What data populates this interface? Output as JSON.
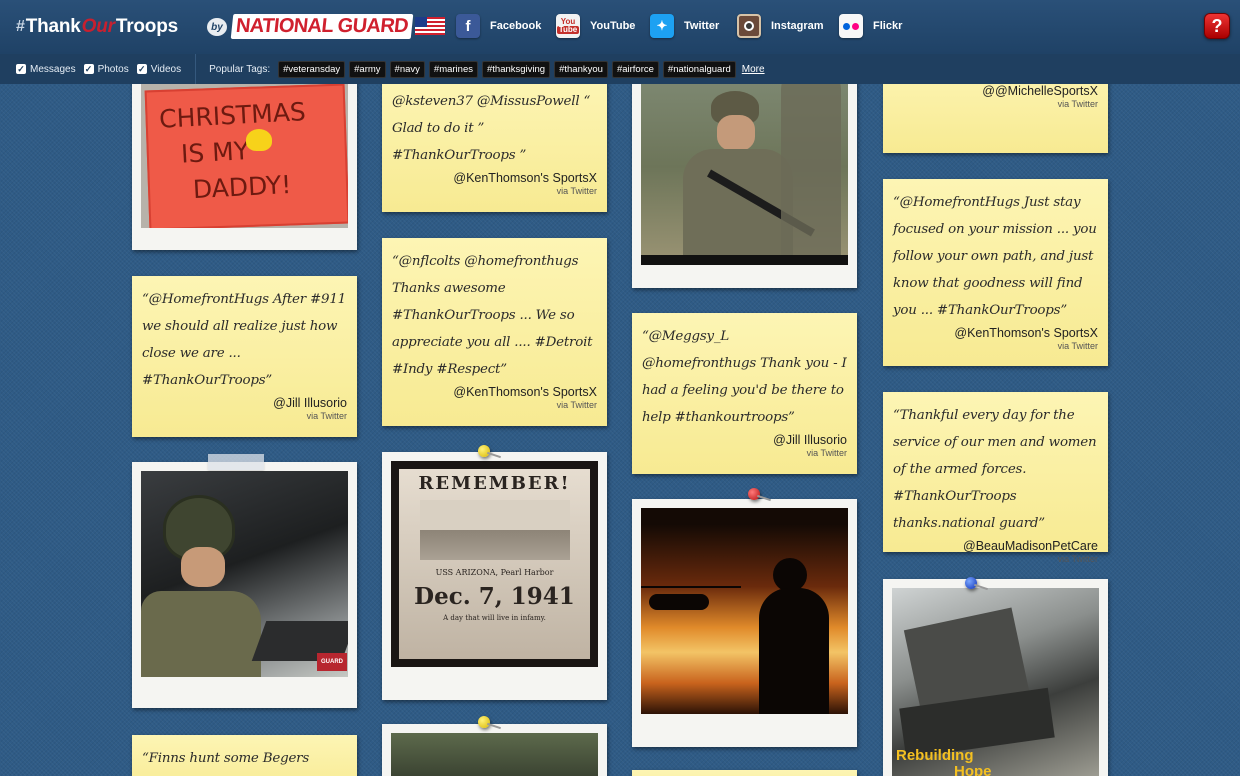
{
  "header": {
    "brand_hash": "#",
    "brand_thank": "Thank",
    "brand_our": "Our",
    "brand_troops": "Troops",
    "by": "by",
    "partner": "NATIONAL GUARD",
    "social": [
      {
        "label": "Facebook",
        "icon": "facebook-icon"
      },
      {
        "label": "YouTube",
        "icon": "youtube-icon"
      },
      {
        "label": "Twitter",
        "icon": "twitter-icon"
      },
      {
        "label": "Instagram",
        "icon": "instagram-icon"
      },
      {
        "label": "Flickr",
        "icon": "flickr-icon"
      }
    ],
    "youtube_you": "You",
    "youtube_tube": "Tube",
    "help": "?"
  },
  "filters": {
    "options": [
      "Messages",
      "Photos",
      "Videos"
    ],
    "popular_label": "Popular Tags:",
    "tags": [
      "#veteransday",
      "#army",
      "#navy",
      "#marines",
      "#thanksgiving",
      "#thankyou",
      "#airforce",
      "#nationalguard"
    ],
    "more": "More"
  },
  "posts": {
    "n1": {
      "quote": "@ksteven37 @MissusPowell “ Glad to do it ” #ThankOurTroops ”",
      "author": "@KenThomson's SportsX",
      "via": "via Twitter"
    },
    "n2": {
      "quote": "“@HomefrontHugs After #911 we should all realize just how close we are ... #ThankOurTroops”",
      "author": "@Jill Illusorio",
      "via": "via Twitter"
    },
    "n3": {
      "quote": "“@nflcolts @homefronthugs Thanks awesome #ThankOurTroops ... We so appreciate you all .... #Detroit #Indy #Respect”",
      "author": "@KenThomson's SportsX",
      "via": "via Twitter"
    },
    "n4": {
      "quote": "“@Meggsy_L @homefronthugs Thank you - I had a feeling you'd be there to help #thankourtroops”",
      "author": "@Jill Illusorio",
      "via": "via Twitter"
    },
    "n5": {
      "author": "@@MichelleSportsX",
      "via": "via Twitter"
    },
    "n6": {
      "quote": "“@HomefrontHugs Just stay focused on your mission ... you follow your own path, and just know that goodness will find you ... #ThankOurTroops”",
      "author": "@KenThomson's SportsX",
      "via": "via Twitter"
    },
    "n7": {
      "quote": "“Thankful every day for the service of our men and women of the armed forces. #ThankOurTroops thanks.national guard”",
      "author": "@BeauMadisonPetCare",
      "via": "via Twitter"
    },
    "n8": {
      "quote": "“Finns hunt some Begers"
    }
  },
  "photos": {
    "sign_line1": "CHRISTMAS",
    "sign_line2": "IS MY",
    "sign_line3": "DADDY!",
    "remember_title": "REMEMBER!",
    "remember_place": "USS ARIZONA, Pearl Harbor",
    "remember_date": "Dec. 7, 1941",
    "remember_sub": "A day that will live in infamy.",
    "ng_badge": "GUARD",
    "rebuilding": "Rebuilding",
    "rebuilding2": "Hope"
  }
}
